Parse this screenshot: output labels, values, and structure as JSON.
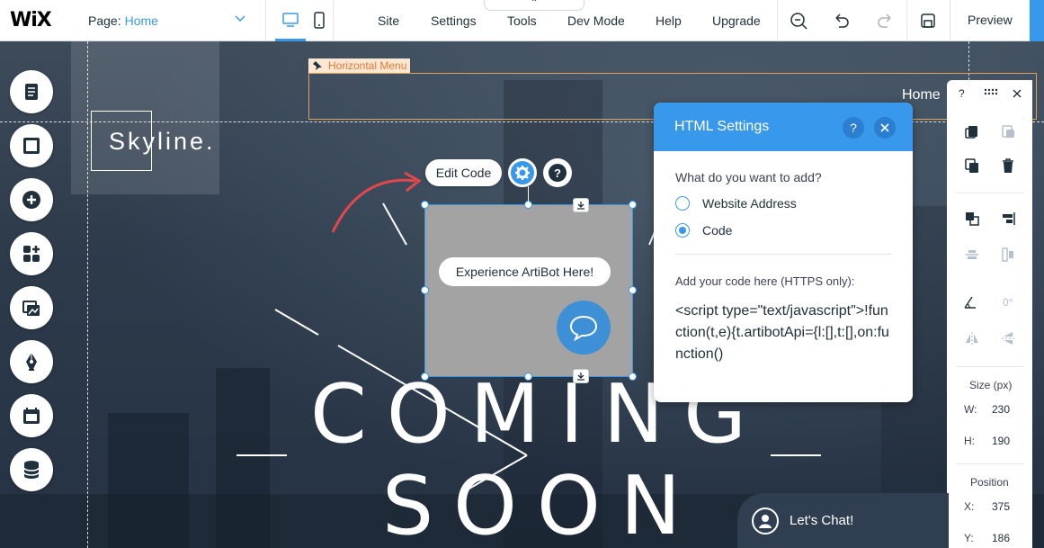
{
  "topbar": {
    "logo": "WiX",
    "page_label": "Page:",
    "page_value": "Home",
    "menu": [
      "Site",
      "Settings",
      "Tools",
      "Dev Mode",
      "Help",
      "Upgrade"
    ],
    "preview": "Preview",
    "collapse_glyph": "⌃"
  },
  "canvas": {
    "menu_tag": "Horizontal Menu",
    "home_link": "Home",
    "logo_text": "Skyline.",
    "headline_1": "COMING",
    "headline_2": "SOON"
  },
  "html_element": {
    "edit_code": "Edit Code",
    "help": "?",
    "bot_prompt": "Experience ArtiBot Here!"
  },
  "settings_panel": {
    "title": "HTML Settings",
    "help": "?",
    "question": "What do you want to add?",
    "options": [
      "Website Address",
      "Code"
    ],
    "selected": "Code",
    "code_label": "Add your code here (HTTPS only):",
    "code": "<script type=\"text/javascript\">!function(t,e){t.artibotApi={l:[],t:[],on:function()"
  },
  "right_toolbar": {
    "help": "?",
    "rotation": "0°",
    "size_label": "Size (px)",
    "w_label": "W:",
    "w_value": "230",
    "h_label": "H:",
    "h_value": "190",
    "position_label": "Position",
    "x_label": "X:",
    "x_value": "375",
    "y_label": "Y:",
    "y_value": "186"
  },
  "chat_widget": {
    "label": "Let's Chat!"
  },
  "colors": {
    "accent": "#3899ec",
    "menu_tag": "#e07b39",
    "annotation_arrow": "#e2474b"
  }
}
